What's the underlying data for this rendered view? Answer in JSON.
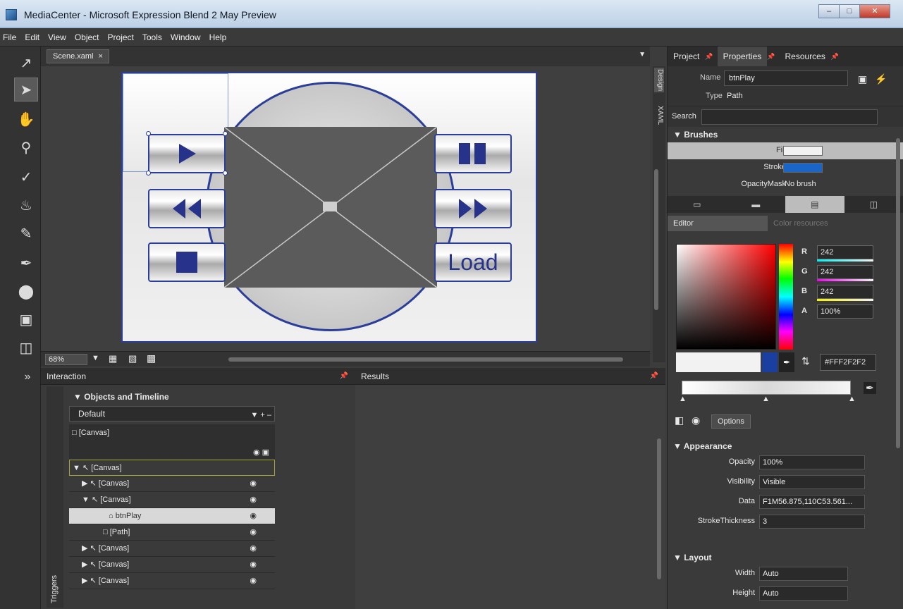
{
  "window": {
    "title": "MediaCenter - Microsoft Expression Blend 2 May Preview"
  },
  "menu": [
    "File",
    "Edit",
    "View",
    "Object",
    "Project",
    "Tools",
    "Window",
    "Help"
  ],
  "document": {
    "tab": "Scene.xaml",
    "side_tabs": [
      "Design",
      "XAML"
    ]
  },
  "artboard": {
    "load_label": "Load"
  },
  "zoom": {
    "value": "68%"
  },
  "interaction": {
    "title": "Interaction",
    "results_title": "Results",
    "objects_timeline": "Objects and Timeline",
    "storyboard": "Default",
    "root": "[Canvas]",
    "triggers_label": "Triggers",
    "tree": [
      {
        "label": "[Canvas]",
        "indent": 0,
        "expanded": true,
        "outlined": true
      },
      {
        "label": "[Canvas]",
        "indent": 1,
        "expanded": false
      },
      {
        "label": "[Canvas]",
        "indent": 1,
        "expanded": true
      },
      {
        "label": "btnPlay",
        "indent": 2,
        "selected": true
      },
      {
        "label": "[Path]",
        "indent": 3
      },
      {
        "label": "[Canvas]",
        "indent": 1,
        "expanded": false
      },
      {
        "label": "[Canvas]",
        "indent": 1,
        "expanded": false
      },
      {
        "label": "[Canvas]",
        "indent": 1,
        "expanded": false
      }
    ]
  },
  "rightpanel": {
    "tabs": [
      "Project",
      "Properties",
      "Resources"
    ],
    "active_tab": "Properties",
    "name_label": "Name",
    "name_value": "btnPlay",
    "type_label": "Type",
    "type_value": "Path",
    "search_label": "Search",
    "brushes": {
      "title": "Brushes",
      "fill_label": "Fill",
      "stroke_label": "Stroke",
      "opacitymask_label": "OpacityMask",
      "opacitymask_value": "No brush",
      "stroke_color": "#1a66c8",
      "editor_tab": "Editor",
      "other_tab": "Color resources",
      "r_label": "R",
      "r_value": "242",
      "g_label": "G",
      "g_value": "242",
      "b_label": "B",
      "b_value": "242",
      "a_label": "A",
      "a_value": "100%",
      "hex": "#FFF2F2F2",
      "options_label": "Options"
    },
    "appearance": {
      "title": "Appearance",
      "opacity_label": "Opacity",
      "opacity_value": "100%",
      "visibility_label": "Visibility",
      "visibility_value": "Visible",
      "data_label": "Data",
      "data_value": "F1M56.875,110C53.561...",
      "stroke_label": "StrokeThickness",
      "stroke_value": "3"
    },
    "layout": {
      "title": "Layout",
      "width_label": "Width",
      "width_value": "Auto",
      "height_label": "Height",
      "height_value": "Auto"
    }
  },
  "colors": {
    "accent": "#2b3f9a",
    "chrome": "#3a3a3a"
  }
}
